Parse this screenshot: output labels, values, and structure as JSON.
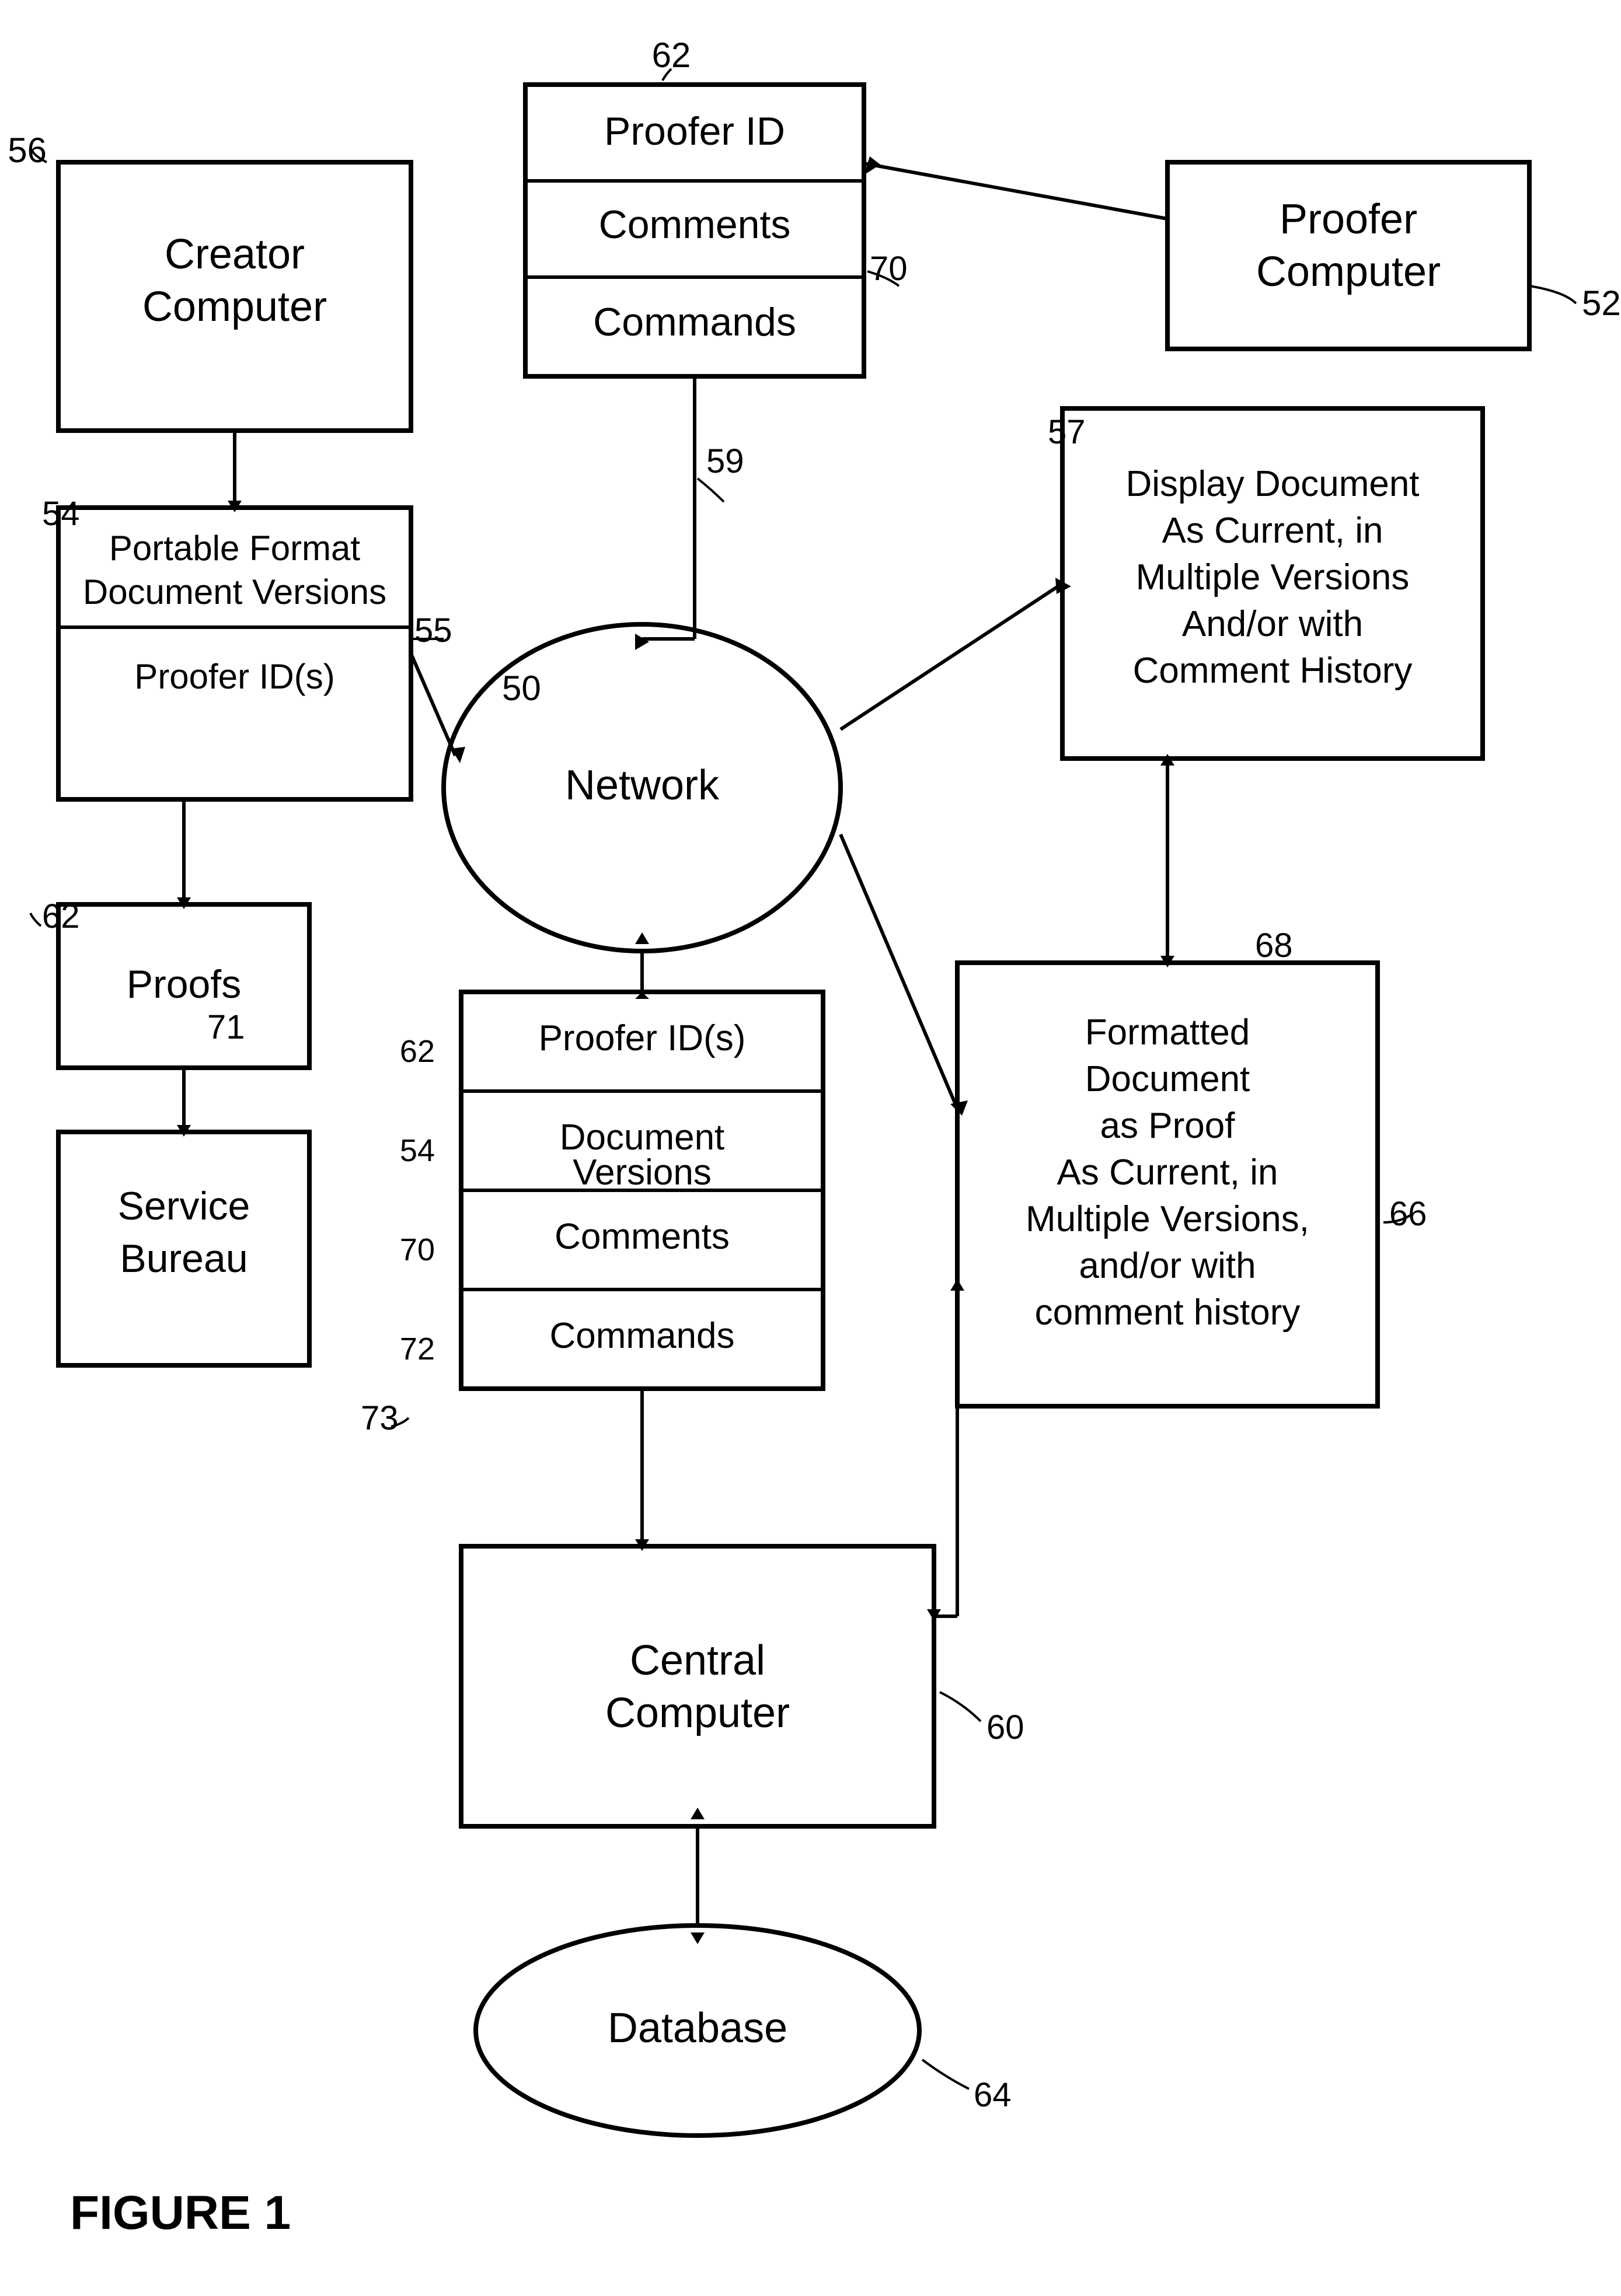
{
  "figure": {
    "label": "FIGURE 1",
    "nodes": {
      "creator_computer": {
        "label": "Creator Computer",
        "ref": "56"
      },
      "proofer_computer": {
        "label": "Proofer Computer",
        "ref": "52"
      },
      "proofer_id_box": {
        "label": "Proofer ID",
        "ref": "62"
      },
      "comments_box": {
        "label": "Comments"
      },
      "commands_top_box": {
        "label": "Commands"
      },
      "network": {
        "label": "Network",
        "ref": "50"
      },
      "portable_format": {
        "label": "Portable Format Document Versions",
        "ref": "54"
      },
      "proofer_ids_sub": {
        "label": "Proofer ID(s)",
        "ref": "55"
      },
      "proofs": {
        "label": "Proofs",
        "ref": "62"
      },
      "service_bureau": {
        "label": "Service Bureau"
      },
      "central_db_box": {
        "items": [
          "Proofer ID(s)",
          "Document Versions",
          "Comments",
          "Commands"
        ],
        "refs": [
          "62",
          "54",
          "70",
          "72"
        ]
      },
      "central_computer": {
        "label": "Central Computer",
        "ref": "60"
      },
      "database": {
        "label": "Database",
        "ref": "64"
      },
      "display_document": {
        "label": "Display Document As Current, in Multiple Versions And/or with Comment History",
        "ref": "57"
      },
      "formatted_document": {
        "label": "Formatted Document as Proof As Current, in Multiple Versions, and/or with comment history",
        "ref": "66"
      },
      "annotation_70": "70",
      "annotation_72": "72",
      "annotation_59": "59",
      "annotation_68": "68",
      "annotation_71": "71",
      "annotation_73": "73"
    }
  }
}
